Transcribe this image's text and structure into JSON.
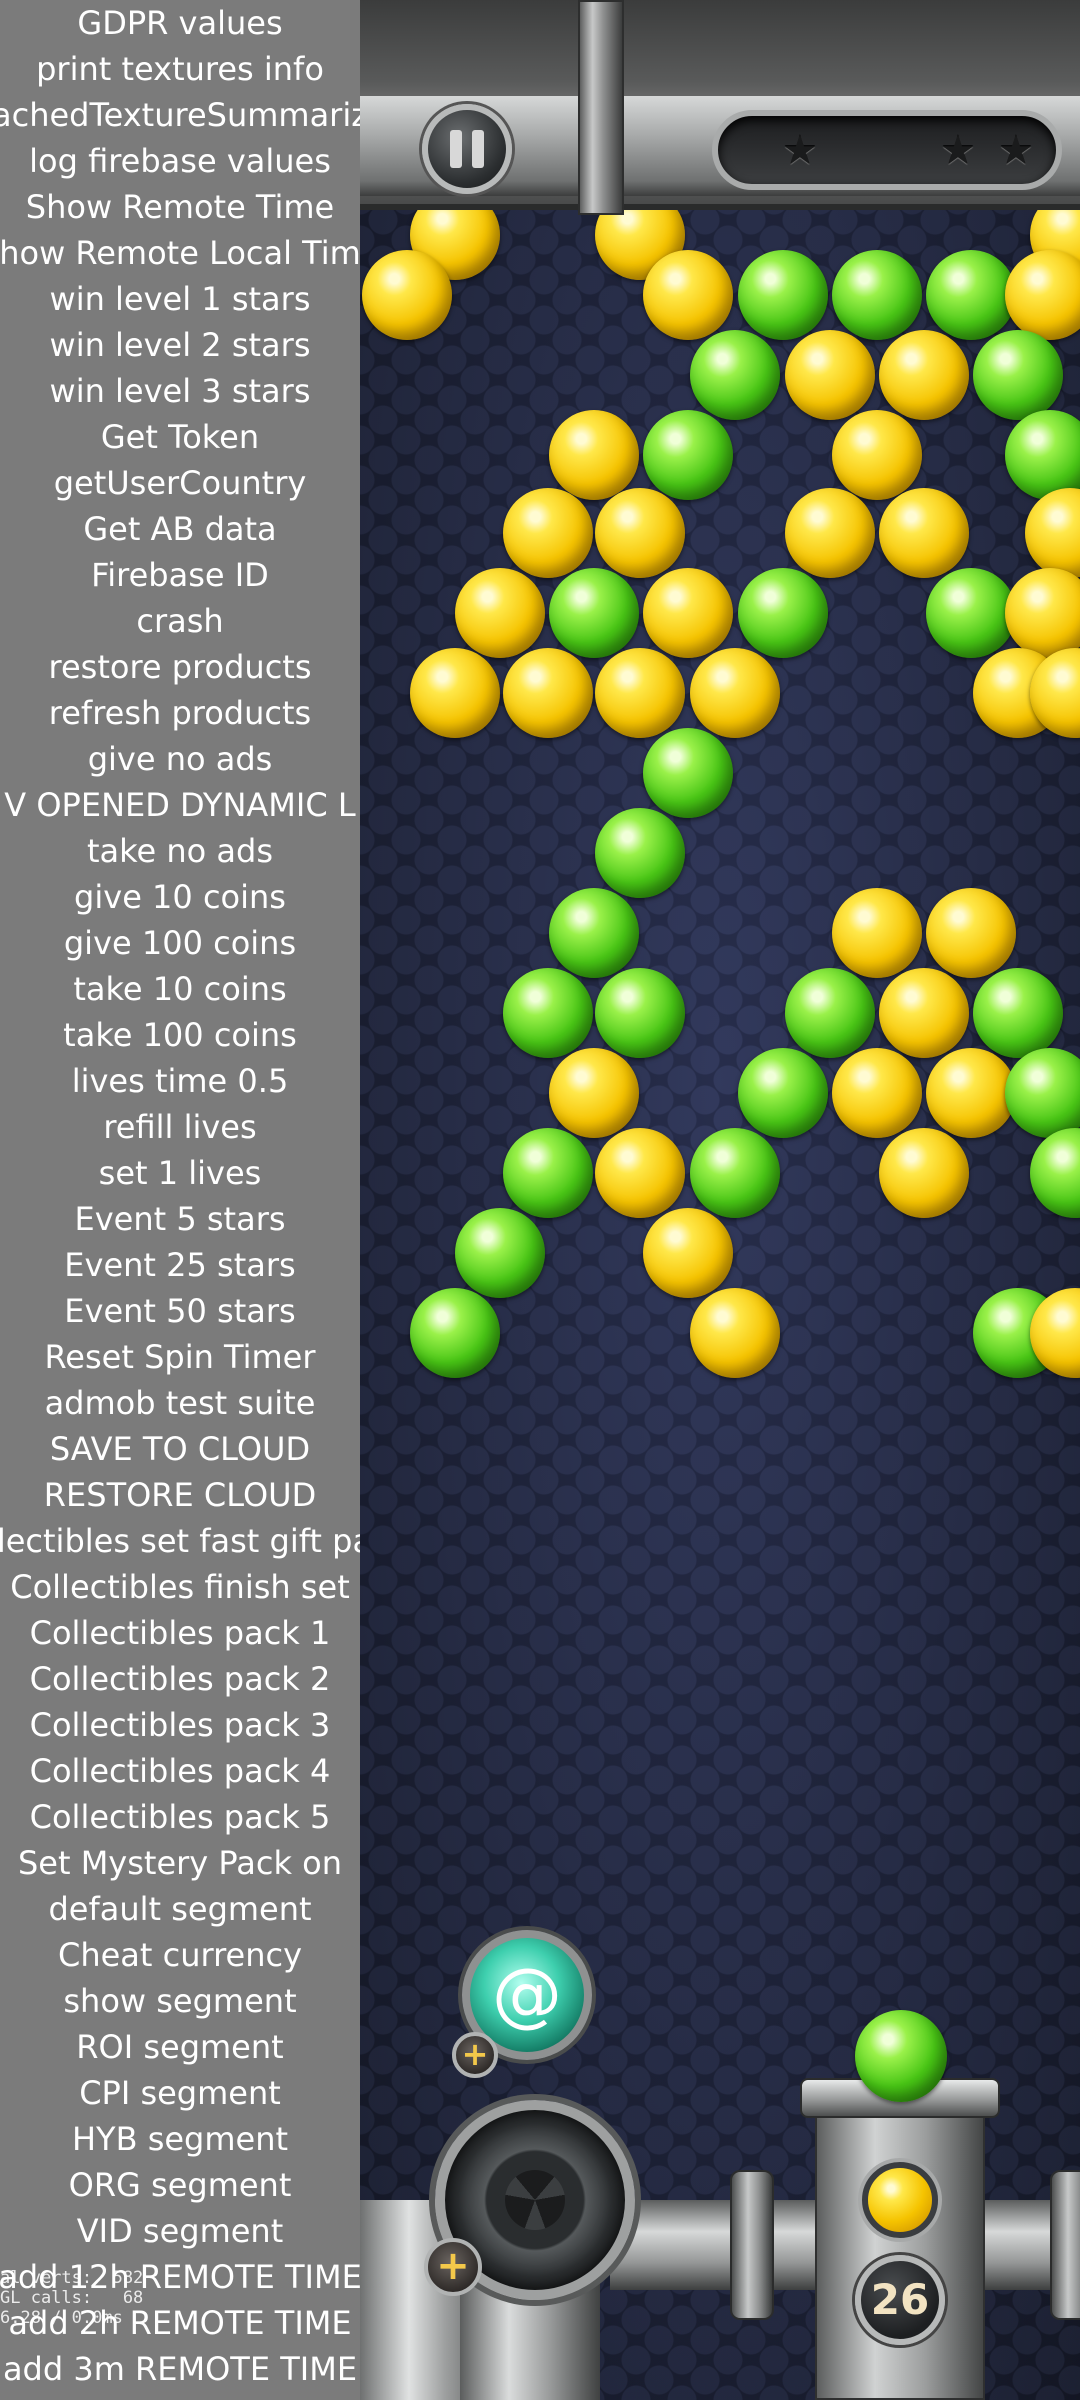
{
  "debug_menu": {
    "items": [
      "GDPR values",
      "print textures info",
      "achedTextureSummariz",
      "log firebase values",
      "Show Remote Time",
      "how Remote Local Tim",
      "win level 1 stars",
      "win level 2 stars",
      "win level 3 stars",
      "Get Token",
      "getUserCountry",
      "Get AB data",
      "Firebase ID",
      "crash",
      "restore products",
      "refresh products",
      "give no ads",
      "V OPENED DYNAMIC L",
      "take no ads",
      "give 10 coins",
      "give 100 coins",
      "take 10 coins",
      "take 100 coins",
      "lives time 0.5",
      "refill lives",
      "set 1 lives",
      "Event 5 stars",
      "Event 25 stars",
      "Event 50 stars",
      "Reset Spin Timer",
      "admob test suite",
      "SAVE TO CLOUD",
      "RESTORE CLOUD",
      "llectibles set fast gift pa",
      "Collectibles finish set",
      "Collectibles pack 1",
      "Collectibles pack 2",
      "Collectibles pack 3",
      "Collectibles pack 4",
      "Collectibles pack 5",
      "Set Mystery Pack on",
      "default segment",
      "Cheat currency",
      "show segment",
      "ROI segment",
      "CPI segment",
      "HYB segment",
      "ORG segment",
      "VID segment",
      "add 12h REMOTE TIME",
      "add 2h REMOTE TIME",
      "add 3m REMOTE TIME"
    ]
  },
  "stats_overlay": {
    "line1": "al verts:  582",
    "line2": "GL calls:   68",
    "line3": "6.28 / 0.0ms"
  },
  "game": {
    "moves_left": "26",
    "meter_stars": [
      "star-icon",
      "star-icon",
      "star-icon"
    ],
    "loaded_bubble_color": "green",
    "next_bubble_color": "yellow",
    "bubbles": [
      [
        "yellow",
        455,
        235
      ],
      [
        "yellow",
        640,
        235
      ],
      [
        "yellow",
        1075,
        235
      ],
      [
        "yellow",
        407,
        295
      ],
      [
        "yellow",
        688,
        295
      ],
      [
        "green",
        783,
        295
      ],
      [
        "green",
        877,
        295
      ],
      [
        "green",
        971,
        295
      ],
      [
        "yellow",
        1050,
        295
      ],
      [
        "green",
        735,
        375
      ],
      [
        "yellow",
        830,
        375
      ],
      [
        "yellow",
        924,
        375
      ],
      [
        "green",
        1018,
        375
      ],
      [
        "yellow",
        594,
        455
      ],
      [
        "green",
        688,
        455
      ],
      [
        "yellow",
        877,
        455
      ],
      [
        "green",
        1050,
        455
      ],
      [
        "yellow",
        548,
        533
      ],
      [
        "yellow",
        640,
        533
      ],
      [
        "yellow",
        830,
        533
      ],
      [
        "yellow",
        924,
        533
      ],
      [
        "yellow",
        1070,
        533
      ],
      [
        "yellow",
        500,
        613
      ],
      [
        "green",
        594,
        613
      ],
      [
        "yellow",
        688,
        613
      ],
      [
        "green",
        783,
        613
      ],
      [
        "green",
        971,
        613
      ],
      [
        "yellow",
        1050,
        613
      ],
      [
        "yellow",
        455,
        693
      ],
      [
        "yellow",
        548,
        693
      ],
      [
        "yellow",
        640,
        693
      ],
      [
        "yellow",
        735,
        693
      ],
      [
        "yellow",
        1018,
        693
      ],
      [
        "yellow",
        1075,
        693
      ],
      [
        "green",
        688,
        773
      ],
      [
        "green",
        640,
        853
      ],
      [
        "green",
        594,
        933
      ],
      [
        "yellow",
        877,
        933
      ],
      [
        "yellow",
        971,
        933
      ],
      [
        "green",
        548,
        1013
      ],
      [
        "green",
        640,
        1013
      ],
      [
        "green",
        830,
        1013
      ],
      [
        "yellow",
        924,
        1013
      ],
      [
        "green",
        1018,
        1013
      ],
      [
        "yellow",
        594,
        1093
      ],
      [
        "green",
        783,
        1093
      ],
      [
        "yellow",
        877,
        1093
      ],
      [
        "yellow",
        971,
        1093
      ],
      [
        "green",
        1050,
        1093
      ],
      [
        "green",
        548,
        1173
      ],
      [
        "yellow",
        640,
        1173
      ],
      [
        "green",
        735,
        1173
      ],
      [
        "yellow",
        924,
        1173
      ],
      [
        "green",
        1075,
        1173
      ],
      [
        "green",
        500,
        1253
      ],
      [
        "yellow",
        688,
        1253
      ],
      [
        "green",
        455,
        1333
      ],
      [
        "yellow",
        735,
        1333
      ],
      [
        "green",
        1018,
        1333
      ],
      [
        "yellow",
        1075,
        1333
      ]
    ]
  },
  "colors": {
    "panel_bg": "#7b7b7b",
    "game_bg": "#1d2236",
    "yellow_bubble": "#f5c300",
    "green_bubble": "#48c515"
  }
}
